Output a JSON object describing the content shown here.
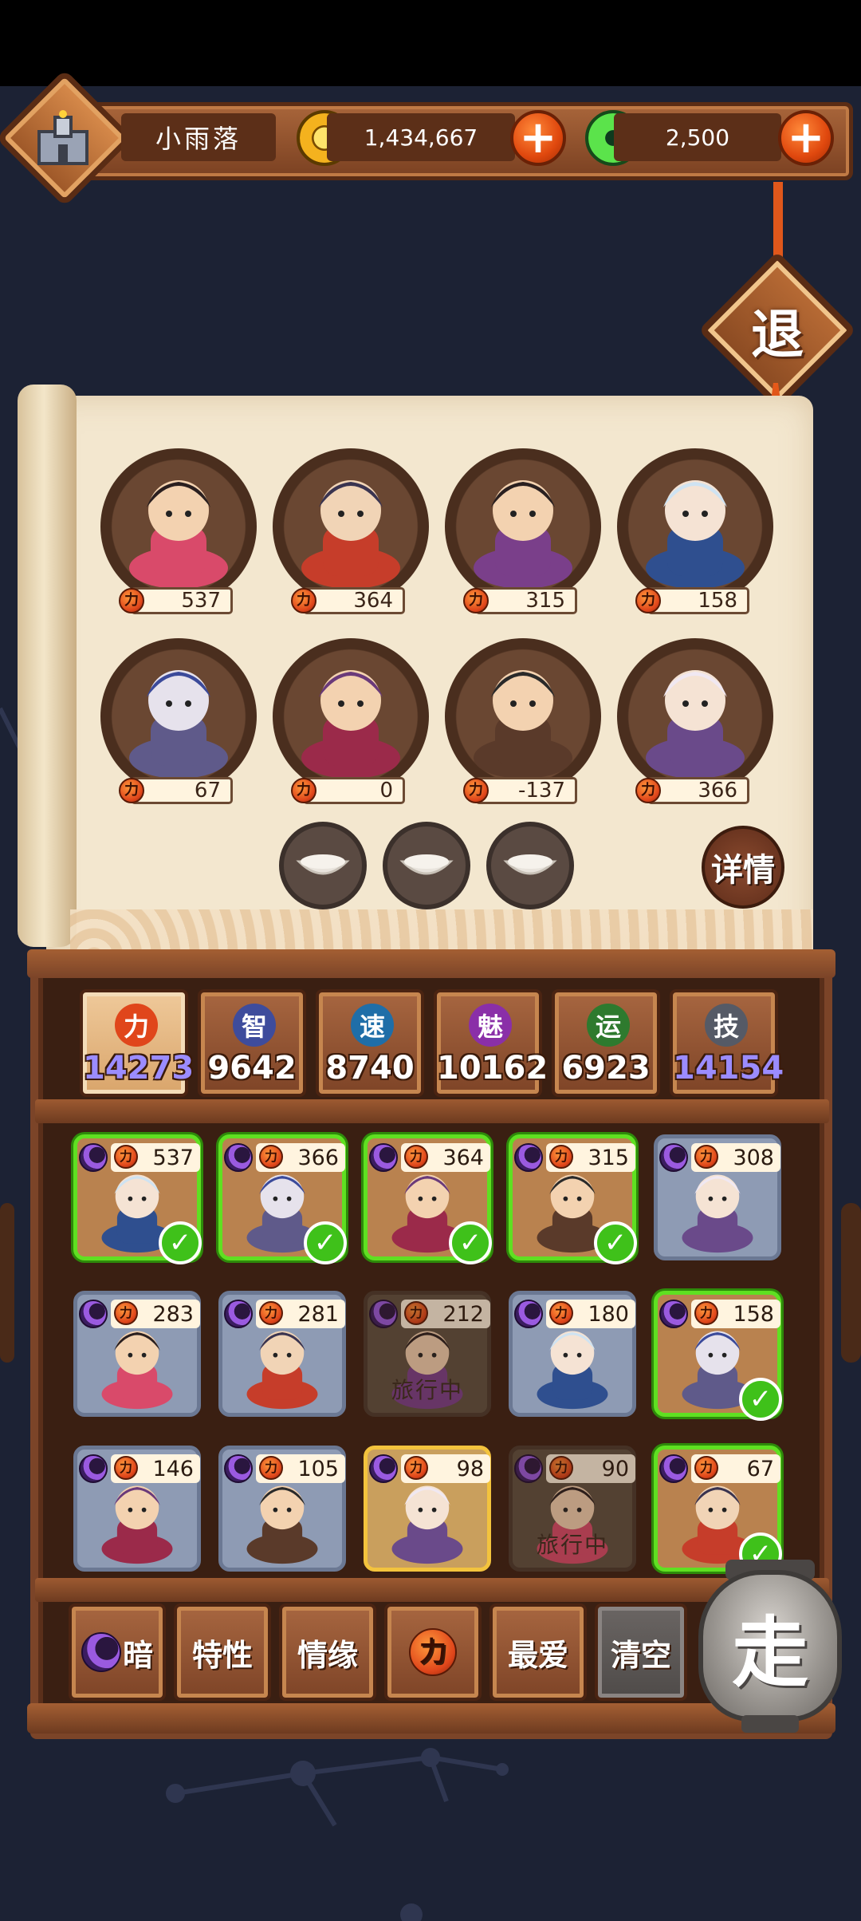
{
  "player": {
    "name": "小雨落"
  },
  "currency": {
    "gold": "1,434,667",
    "jade": "2,500"
  },
  "exit_label": "退",
  "team": [
    {
      "power": "537"
    },
    {
      "power": "364"
    },
    {
      "power": "315"
    },
    {
      "power": "158"
    },
    {
      "power": "67"
    },
    {
      "power": "0"
    },
    {
      "power": "-137"
    },
    {
      "power": "366"
    }
  ],
  "detail_label": "详情",
  "power_glyph": "力",
  "stats": [
    {
      "glyph": "力",
      "value": "14273",
      "color": "#e0461b",
      "highlight": true,
      "active": true
    },
    {
      "glyph": "智",
      "value": "9642",
      "color": "#3e4c9c",
      "highlight": false,
      "active": false
    },
    {
      "glyph": "速",
      "value": "8740",
      "color": "#1f6ea8",
      "highlight": false,
      "active": false
    },
    {
      "glyph": "魅",
      "value": "10162",
      "color": "#8a2fa8",
      "highlight": false,
      "active": false
    },
    {
      "glyph": "运",
      "value": "6923",
      "color": "#2e7a2e",
      "highlight": false,
      "active": false
    },
    {
      "glyph": "技",
      "value": "14154",
      "color": "#555a66",
      "highlight": true,
      "active": false
    }
  ],
  "heroes": [
    {
      "power": "537",
      "state": "selected"
    },
    {
      "power": "366",
      "state": "selected"
    },
    {
      "power": "364",
      "state": "selected"
    },
    {
      "power": "315",
      "state": "selected"
    },
    {
      "power": "308",
      "state": "normal"
    },
    {
      "power": "283",
      "state": "normal"
    },
    {
      "power": "281",
      "state": "normal"
    },
    {
      "power": "212",
      "state": "locked",
      "locked_text": "旅行中"
    },
    {
      "power": "180",
      "state": "normal"
    },
    {
      "power": "158",
      "state": "selected"
    },
    {
      "power": "146",
      "state": "normal"
    },
    {
      "power": "105",
      "state": "normal"
    },
    {
      "power": "98",
      "state": "gold"
    },
    {
      "power": "90",
      "state": "locked",
      "locked_text": "旅行中"
    },
    {
      "power": "67",
      "state": "selected"
    }
  ],
  "filters": {
    "dark": "暗",
    "trait": "特性",
    "bond": "情缘",
    "power": "力",
    "favorite": "最爱",
    "clear": "清空"
  },
  "go_label": "走",
  "check_glyph": "✓"
}
